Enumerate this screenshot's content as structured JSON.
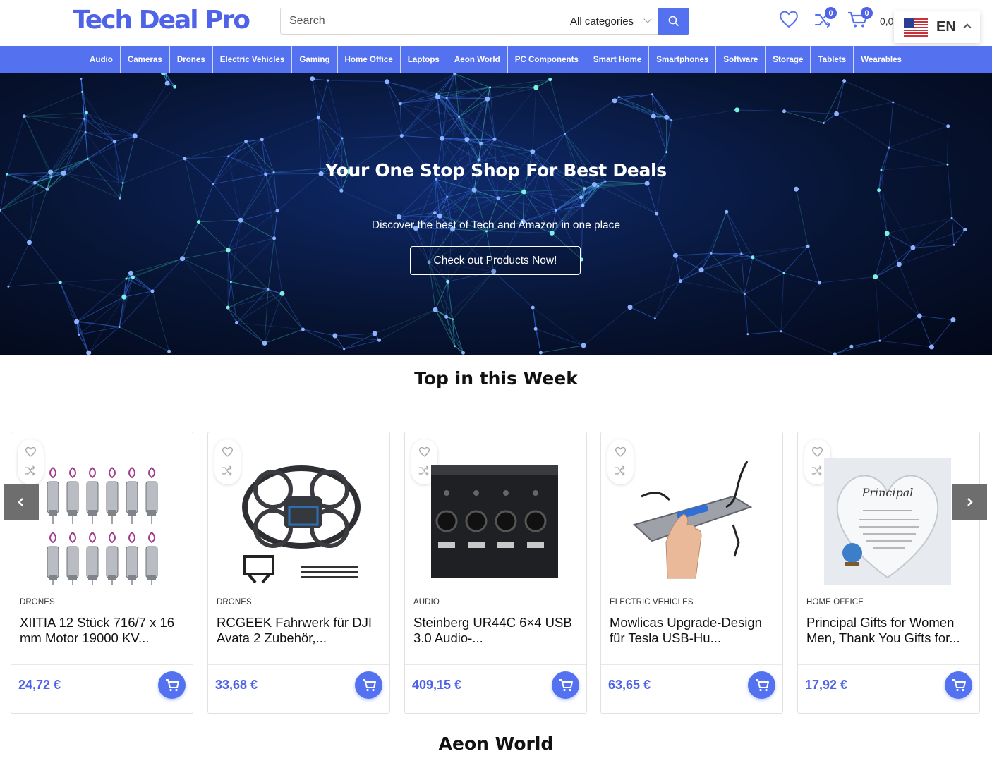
{
  "header": {
    "logo_text": "Tech Deal Pro",
    "search_placeholder": "Search",
    "category_selected": "All categories",
    "compare_count": "0",
    "cart_count": "0",
    "cart_total": "0,0",
    "language_code": "EN",
    "accent_color": "#5472f0"
  },
  "nav": {
    "items": [
      "Audio",
      "Cameras",
      "Drones",
      "Electric Vehicles",
      "Gaming",
      "Home Office",
      "Laptops",
      "Aeon World",
      "PC Components",
      "Smart Home",
      "Smartphones",
      "Software",
      "Storage",
      "Tablets",
      "Wearables"
    ]
  },
  "hero": {
    "title": "Your One Stop Shop For Best Deals",
    "subtitle": "Discover the best of Tech and Amazon in one place",
    "button_label": "Check out Products Now!"
  },
  "sections": {
    "top_week_title": "Top in this Week",
    "next_section_title": "Aeon World"
  },
  "products": [
    {
      "category": "DRONES",
      "title": "XIITIA 12 Stück 716/7 x 16 mm Motor 19000 KV...",
      "price": "24,72 €",
      "image": "drone-motors"
    },
    {
      "category": "DRONES",
      "title": "RCGEEK Fahrwerk für DJI Avata 2 Zubehör,...",
      "price": "33,68 €",
      "image": "drone-landing-gear"
    },
    {
      "category": "AUDIO",
      "title": "Steinberg UR44C 6×4 USB 3.0 Audio-...",
      "price": "409,15 €",
      "image": "audio-interface"
    },
    {
      "category": "ELECTRIC VEHICLES",
      "title": "Mowlicas Upgrade-Design für Tesla USB-Hu...",
      "price": "63,65 €",
      "image": "usb-hub"
    },
    {
      "category": "HOME OFFICE",
      "title": "Principal Gifts for Women Men, Thank You Gifts for...",
      "price": "17,92 €",
      "image": "acrylic-heart-plaque"
    }
  ]
}
